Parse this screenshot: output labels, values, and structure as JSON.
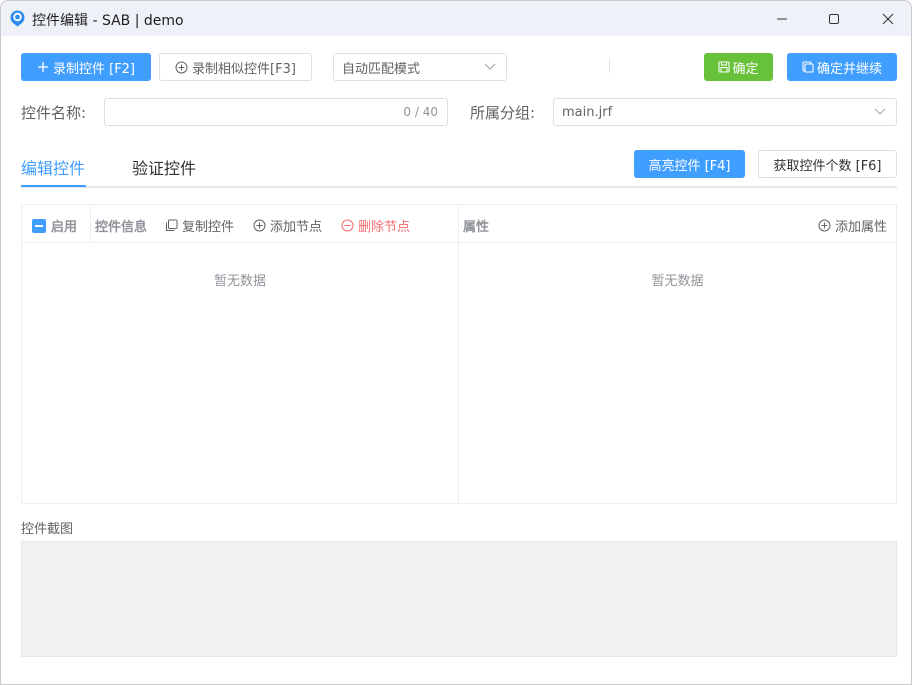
{
  "window": {
    "title": "控件编辑 - SAB | demo"
  },
  "toolbar": {
    "record_label": "录制控件 [F2]",
    "record_similar_label": "录制相似控件[F3]",
    "match_mode_value": "自动匹配模式",
    "confirm_label": "确定",
    "confirm_continue_label": "确定并继续"
  },
  "form": {
    "name_label": "控件名称:",
    "name_value": "",
    "name_counter": "0 / 40",
    "group_label": "所属分组:",
    "group_value": "main.jrf"
  },
  "tabs": {
    "edit_label": "编辑控件",
    "verify_label": "验证控件",
    "highlight_label": "高亮控件 [F4]",
    "count_label": "获取控件个数 [F6]"
  },
  "left_panel": {
    "enable_label": "启用",
    "info_label": "控件信息",
    "copy_label": "复制控件",
    "add_node_label": "添加节点",
    "delete_node_label": "删除节点",
    "empty_text": "暂无数据"
  },
  "right_panel": {
    "attr_label": "属性",
    "add_attr_label": "添加属性",
    "empty_text": "暂无数据"
  },
  "screenshot": {
    "label": "控件截图"
  },
  "colors": {
    "primary": "#409eff",
    "success": "#67c23a",
    "danger": "#f56c6c"
  }
}
